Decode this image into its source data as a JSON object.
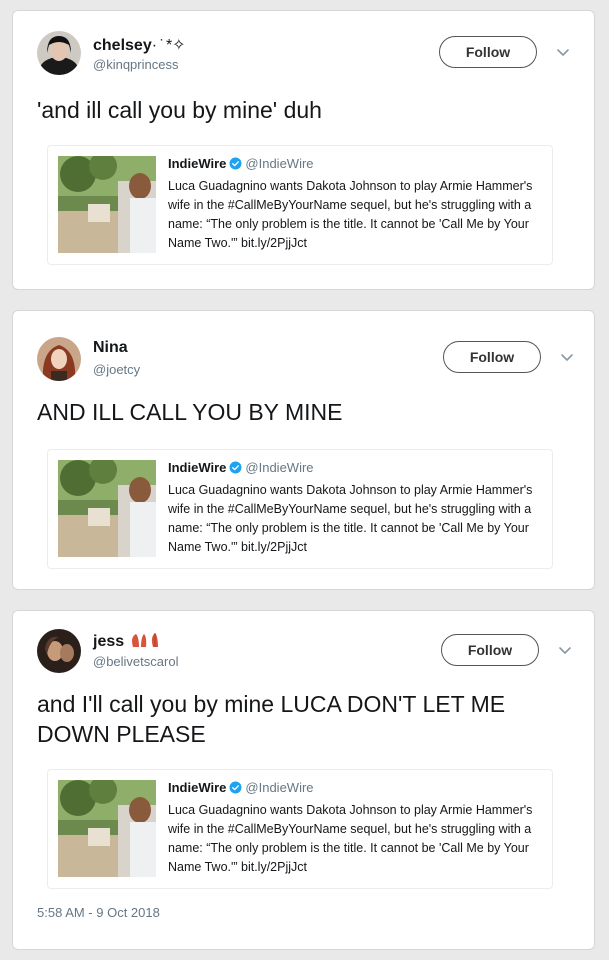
{
  "tweets": [
    {
      "name": "chelsey",
      "name_decoration": "· ̇ *✧",
      "handle": "@kinqprincess",
      "follow_label": "Follow",
      "text": "'and ill call you by mine' duh",
      "quote": {
        "name": "IndieWire",
        "handle": "@IndieWire",
        "text": "Luca Guadagnino wants Dakota Johnson to play Armie Hammer's wife in the #CallMeByYourName sequel, but he's struggling with a name: “The only problem is the title. It cannot be 'Call Me by Your Name Two.'” bit.ly/2PjjJct"
      }
    },
    {
      "name": "Nina",
      "name_decoration": "",
      "handle": "@joetcy",
      "follow_label": "Follow",
      "text": "AND ILL CALL YOU BY MINE",
      "quote": {
        "name": "IndieWire",
        "handle": "@IndieWire",
        "text": "Luca Guadagnino wants Dakota Johnson to play Armie Hammer's wife in the #CallMeByYourName sequel, but he's struggling with a name: “The only problem is the title. It cannot be 'Call Me by Your Name Two.'” bit.ly/2PjjJct"
      }
    },
    {
      "name": "jess",
      "name_decoration": "",
      "handle": "@belivetscarol",
      "follow_label": "Follow",
      "text": "and I'll call you by mine LUCA DON'T LET ME DOWN PLEASE",
      "quote": {
        "name": "IndieWire",
        "handle": "@IndieWire",
        "text": "Luca Guadagnino wants Dakota Johnson to play Armie Hammer's wife in the #CallMeByYourName sequel, but he's struggling with a name: “The only problem is the title. It cannot be 'Call Me by Your Name Two.'” bit.ly/2PjjJct"
      },
      "timestamp": "5:58 AM - 9 Oct 2018"
    }
  ],
  "colors": {
    "verified": "#1da1f2",
    "handle": "#657786",
    "text": "#14171a",
    "name_emoji": "#d8553b"
  },
  "icons": [
    "verified-badge-icon",
    "chevron-down-icon",
    "lungs-emoji-icon"
  ]
}
